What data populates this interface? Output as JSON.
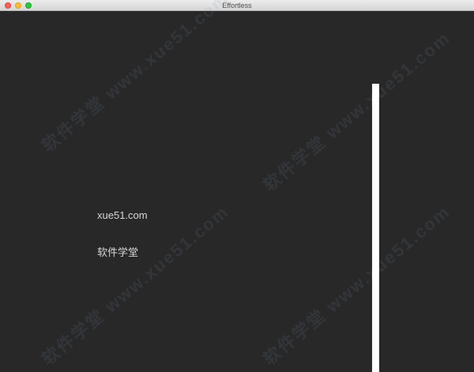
{
  "window": {
    "title": "Effortless"
  },
  "editor": {
    "lines": [
      "xue51.com",
      "软件学堂"
    ]
  },
  "watermark": {
    "text": "软件学堂 www.xue51.com"
  },
  "colors": {
    "background": "#282828",
    "text": "#d8d8d8",
    "cursor": "#ffffff",
    "close": "#fc5f57",
    "minimize": "#fdbc2e",
    "zoom": "#28c840"
  }
}
